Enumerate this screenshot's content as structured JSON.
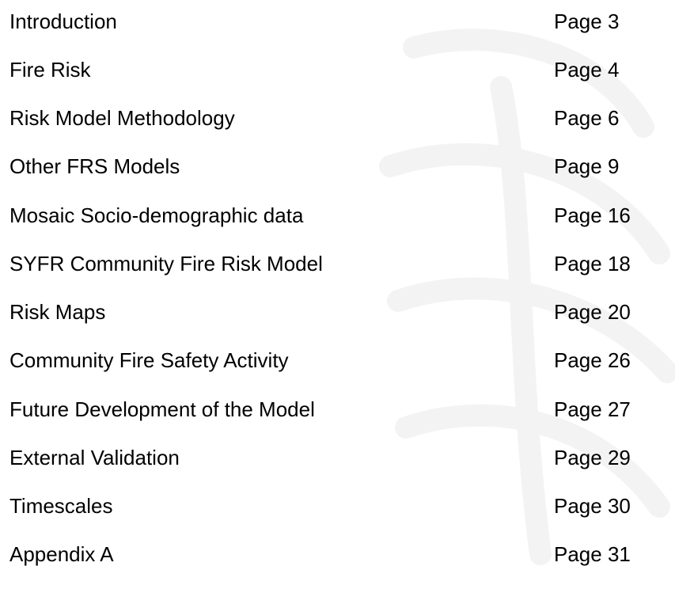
{
  "toc": {
    "entries": [
      {
        "title": "Introduction",
        "page": "Page 3"
      },
      {
        "title": "Fire Risk",
        "page": "Page 4"
      },
      {
        "title": "Risk Model Methodology",
        "page": "Page 6"
      },
      {
        "title": "Other FRS Models",
        "page": "Page 9"
      },
      {
        "title": "Mosaic Socio-demographic data",
        "page": "Page 16"
      },
      {
        "title": "SYFR Community Fire Risk Model",
        "page": "Page 18"
      },
      {
        "title": "Risk Maps",
        "page": "Page 20"
      },
      {
        "title": "Community Fire Safety Activity",
        "page": "Page 26"
      },
      {
        "title": "Future Development of the Model",
        "page": "Page 27"
      },
      {
        "title": "External Validation",
        "page": "Page 29"
      },
      {
        "title": "Timescales",
        "page": "Page 30"
      },
      {
        "title": "Appendix A",
        "page": "Page 31"
      }
    ]
  },
  "colors": {
    "text": "#000000",
    "background": "#ffffff",
    "watermark": "#f3f3f3"
  }
}
